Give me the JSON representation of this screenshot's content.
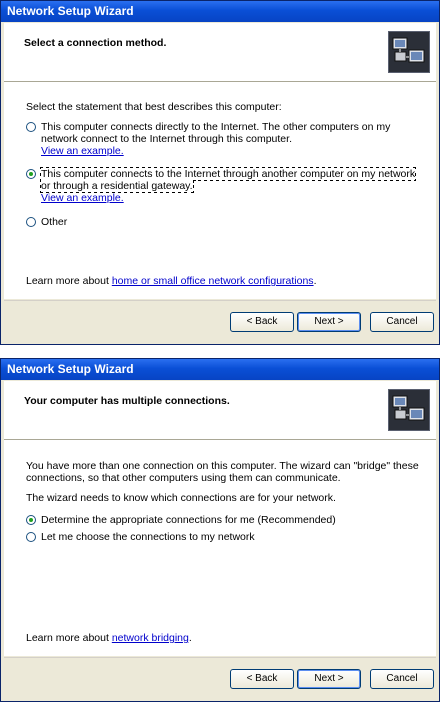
{
  "window1": {
    "title": "Network Setup Wizard",
    "header_title": "Select a connection method.",
    "prompt": "Select the statement that best describes this computer:",
    "options": [
      {
        "text": "This computer connects directly to the Internet. The other computers on my network connect to the Internet through this computer.",
        "link": "View an example.",
        "selected": false
      },
      {
        "text": "This computer connects to the Internet through another computer on my network or through a residential gateway.",
        "link": "View an example.",
        "selected": true
      },
      {
        "text": "Other",
        "selected": false
      }
    ],
    "learn_prefix": "Learn more about ",
    "learn_link": "home or small office network configurations",
    "learn_suffix": ".",
    "buttons": {
      "back": "< Back",
      "next": "Next >",
      "cancel": "Cancel"
    }
  },
  "window2": {
    "title": "Network Setup Wizard",
    "header_title": "Your computer has multiple connections.",
    "para1": "You have more than one connection on this computer. The wizard can \"bridge\" these connections, so that other computers using them can communicate.",
    "para2": "The wizard needs to know which connections are for your network.",
    "options": [
      {
        "text": "Determine the appropriate connections for me (Recommended)",
        "selected": true
      },
      {
        "text": "Let me choose the connections to my network",
        "selected": false
      }
    ],
    "learn_prefix": "Learn more about ",
    "learn_link": "network bridging",
    "learn_suffix": ".",
    "buttons": {
      "back": "< Back",
      "next": "Next >",
      "cancel": "Cancel"
    }
  }
}
